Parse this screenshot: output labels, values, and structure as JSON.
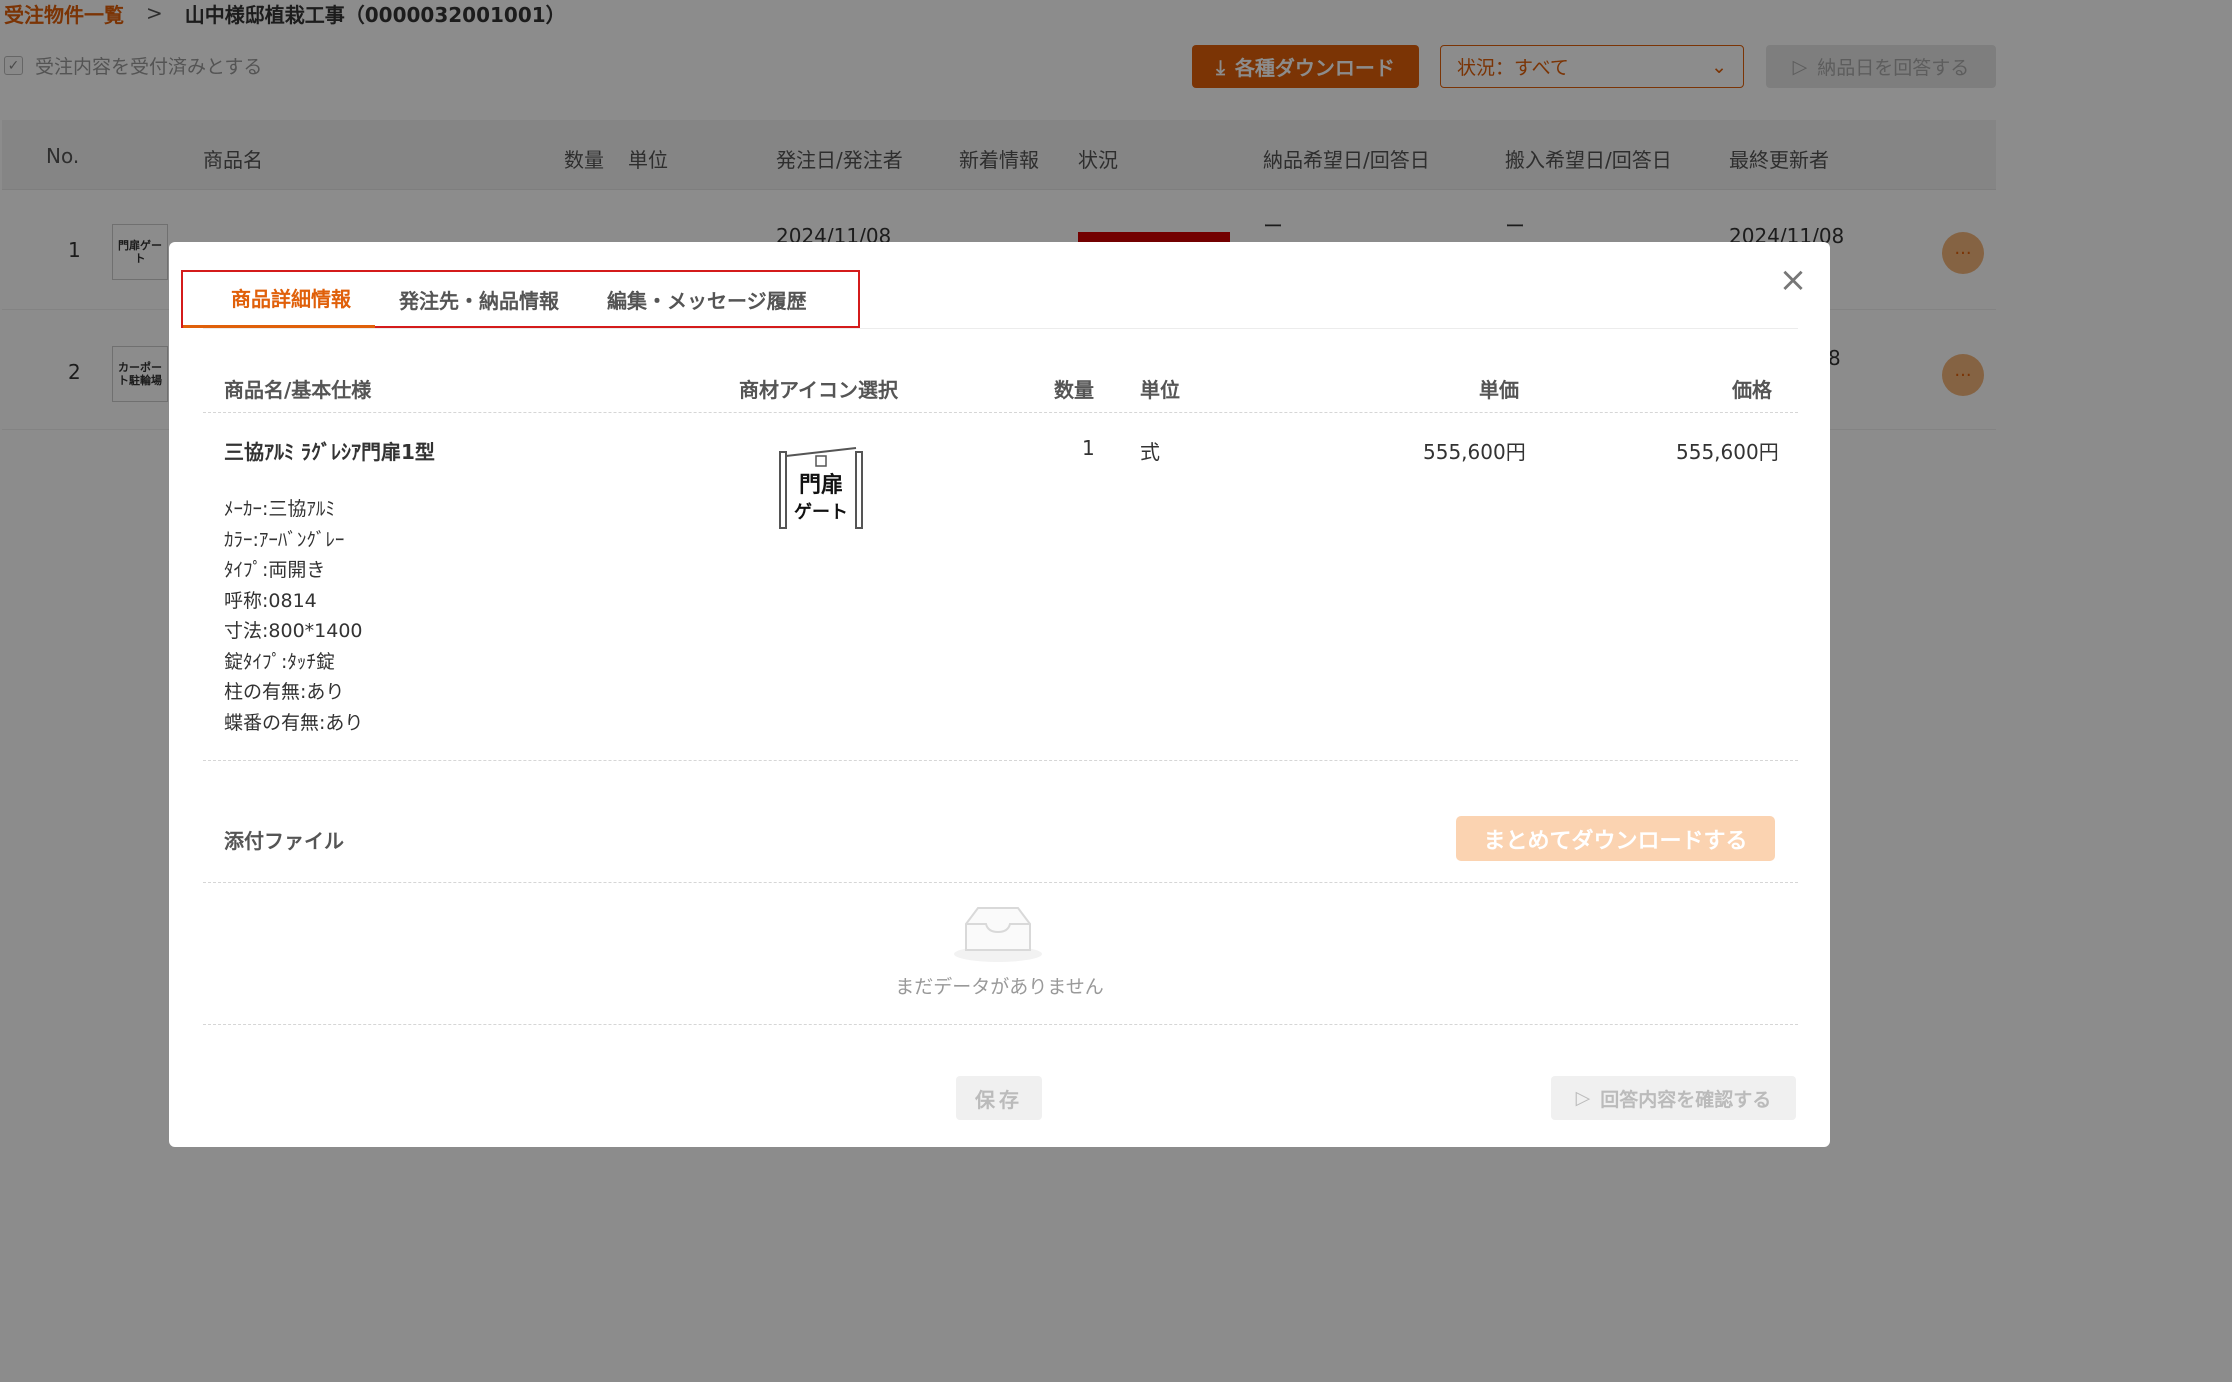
{
  "breadcrumb": {
    "parent": "受注物件一覧",
    "separator": ">",
    "current": "山中様邸植栽工事（0000032001001）"
  },
  "toolbar": {
    "ack_label": "受注内容を受付済みとする",
    "download_label": "各種ダウンロード",
    "status_select_value": "状況：すべて",
    "answer_date_label": "納品日を回答する"
  },
  "table": {
    "columns": [
      "No.",
      "商品名",
      "数量",
      "単位",
      "発注日/発注者",
      "新着情報",
      "状況",
      "納品希望日/回答日",
      "搬入希望日/回答日",
      "最終更新者"
    ],
    "rows": [
      {
        "no": "1",
        "icon_text": "門扉ゲート",
        "date": "2024/11/08",
        "delivery": "ー",
        "carry_in": "ー",
        "updated": "2024/11/08",
        "more": "···"
      },
      {
        "no": "2",
        "icon_text": "カーポート駐輪場",
        "updated_partial": "8",
        "more": "···"
      }
    ]
  },
  "modal": {
    "tabs": [
      "商品詳細情報",
      "発注先・納品情報",
      "編集・メッセージ履歴"
    ],
    "headers": {
      "name_spec": "商品名/基本仕様",
      "icon_select": "商材アイコン選択",
      "qty": "数量",
      "unit": "単位",
      "unit_price": "単価",
      "price": "価格"
    },
    "item": {
      "name": "三協ｱﾙﾐ ﾗｸﾞﾚｼｱ門扉1型",
      "specs": [
        "ﾒｰｶｰ:三協ｱﾙﾐ",
        "ｶﾗｰ:ｱｰﾊﾞﾝｸﾞﾚｰ",
        "ﾀｲﾌﾟ:両開き",
        "呼称:0814",
        "寸法:800*1400",
        "錠ﾀｲﾌﾟ:ﾀｯﾁ錠",
        "柱の有無:あり",
        "蝶番の有無:あり"
      ],
      "icon_text_top": "門扉",
      "icon_text_bottom": "ゲート",
      "qty": "1",
      "unit": "式",
      "unit_price": "555,600円",
      "price": "555,600円"
    },
    "attachments": {
      "label": "添付ファイル",
      "bulk_download_label": "まとめてダウンロードする",
      "empty_text": "まだデータがありません"
    },
    "footer": {
      "save_label": "保存",
      "confirm_label": "回答内容を確認する"
    }
  },
  "colors": {
    "accent": "#e0600a",
    "highlight_border": "#d41b1b",
    "status_red": "#d10000"
  }
}
